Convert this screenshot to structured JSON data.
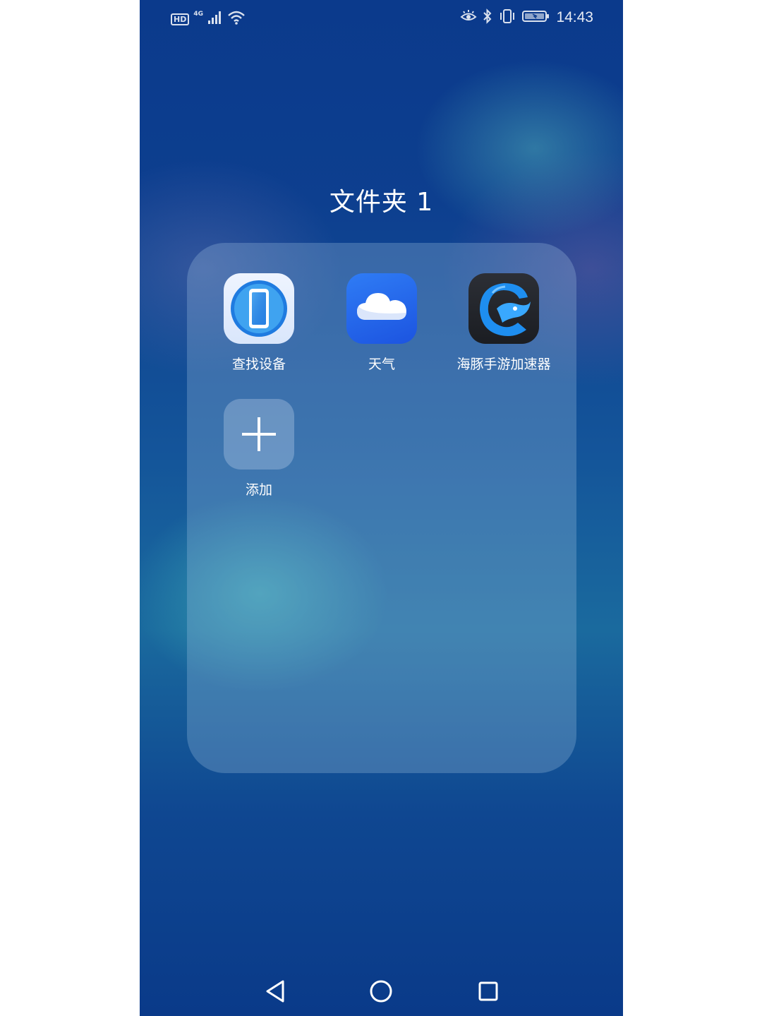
{
  "status_bar": {
    "hd_label": "HD",
    "network_type": "4G",
    "time": "14:43",
    "icons": [
      "signal-icon",
      "wifi-icon",
      "eye-comfort-icon",
      "bluetooth-icon",
      "vibrate-icon",
      "battery-icon"
    ]
  },
  "folder": {
    "title": "文件夹 1",
    "apps": [
      {
        "label": "查找设备",
        "icon": "find-device-icon"
      },
      {
        "label": "天气",
        "icon": "weather-icon"
      },
      {
        "label": "海豚手游加速器",
        "icon": "dolphin-accelerator-icon"
      },
      {
        "label": "添加",
        "icon": "plus-icon"
      }
    ]
  },
  "nav_bar": {
    "buttons": [
      "back-icon",
      "home-icon",
      "recents-icon"
    ]
  },
  "colors": {
    "weather_icon_bg": "#2f7cf5",
    "find_device_ring": "#1f7be0",
    "dolphin_blue": "#1e8ef0"
  }
}
